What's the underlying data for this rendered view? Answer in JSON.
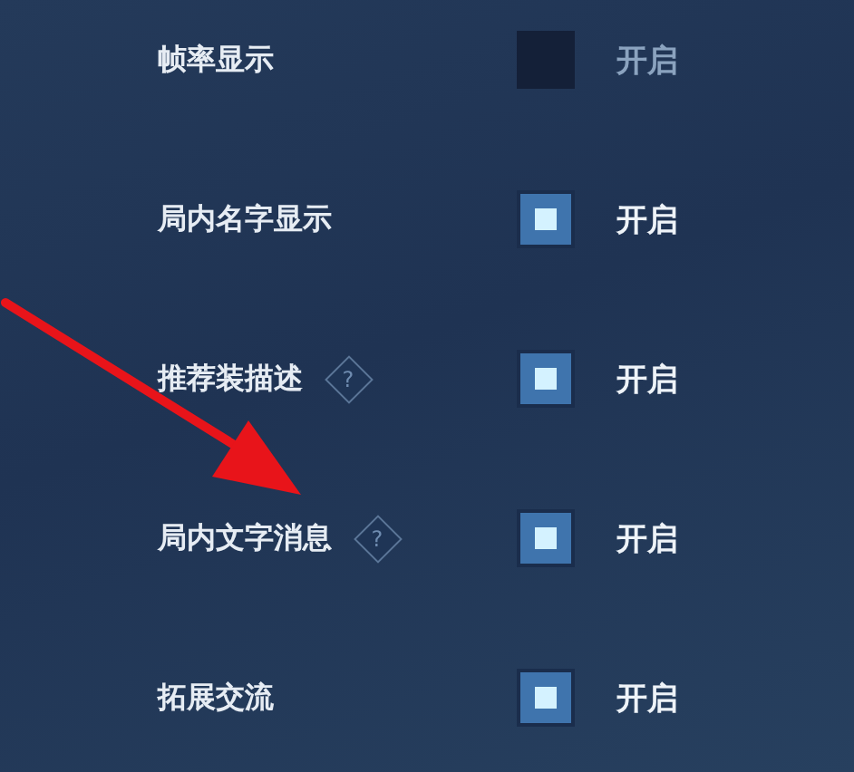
{
  "settings": [
    {
      "label": "帧率显示",
      "checked": false,
      "state_text": "开启"
    },
    {
      "label": "局内名字显示",
      "checked": true,
      "state_text": "开启"
    },
    {
      "label": "推荐装描述",
      "help": "?",
      "checked": true,
      "state_text": "开启"
    },
    {
      "label": "局内文字消息",
      "help": "?",
      "checked": true,
      "state_text": "开启"
    },
    {
      "label": "拓展交流",
      "checked": true,
      "state_text": "开启"
    }
  ]
}
